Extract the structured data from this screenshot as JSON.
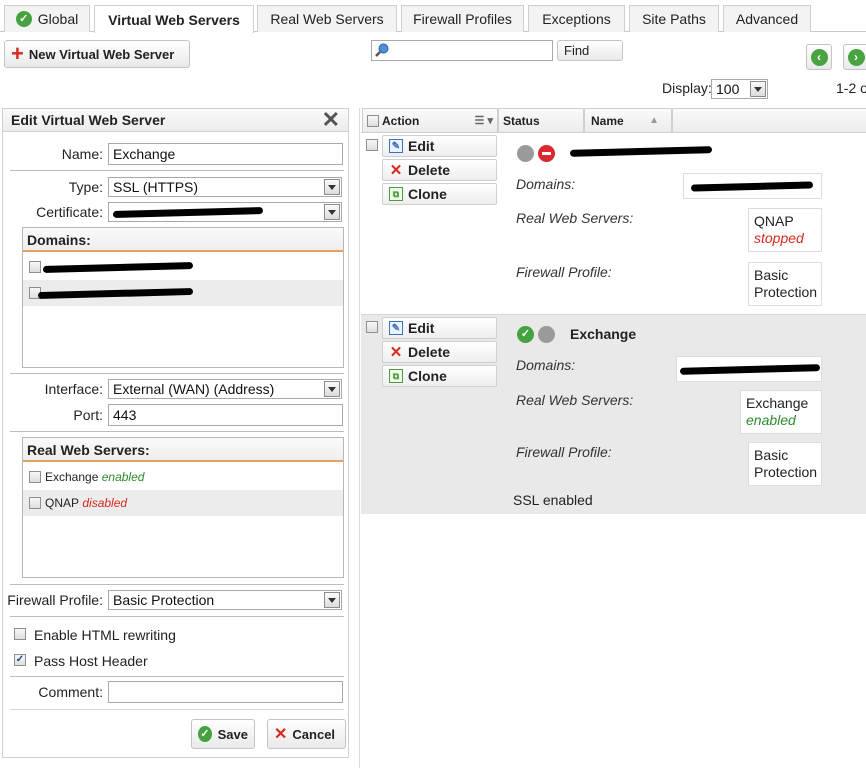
{
  "tabs": [
    {
      "label": "Global",
      "icon": "check-circle-icon"
    },
    {
      "label": "Virtual Web Servers",
      "active": true
    },
    {
      "label": "Real Web Servers"
    },
    {
      "label": "Firewall Profiles"
    },
    {
      "label": "Exceptions"
    },
    {
      "label": "Site Paths"
    },
    {
      "label": "Advanced"
    }
  ],
  "toolbar": {
    "new_button": "New Virtual Web Server",
    "search_value": "",
    "find_button": "Find",
    "display_label": "Display:",
    "display_value": "100",
    "pager_text": "1-2 o"
  },
  "edit_panel": {
    "title": "Edit Virtual Web Server",
    "name_label": "Name:",
    "name_value": "Exchange",
    "type_label": "Type:",
    "type_value": "SSL (HTTPS)",
    "certificate_label": "Certificate:",
    "domains_header": "Domains:",
    "interface_label": "Interface:",
    "interface_value": "External (WAN) (Address)",
    "port_label": "Port:",
    "port_value": "443",
    "real_servers_header": "Real Web Servers:",
    "real_servers": [
      {
        "name": "Exchange",
        "status": "enabled",
        "checked": false
      },
      {
        "name": "QNAP",
        "status": "disabled",
        "checked": false
      }
    ],
    "firewall_label": "Firewall Profile:",
    "firewall_value": "Basic Protection",
    "html_rewriting_label": "Enable HTML rewriting",
    "html_rewriting_checked": false,
    "pass_host_label": "Pass Host Header",
    "pass_host_checked": true,
    "comment_label": "Comment:",
    "comment_value": "",
    "save_button": "Save",
    "cancel_button": "Cancel"
  },
  "grid": {
    "headers": {
      "action": "Action",
      "status": "Status",
      "name": "Name"
    },
    "rows": [
      {
        "status": "disabled",
        "name": "",
        "domains_label": "Domains:",
        "real_servers_label": "Real Web Servers:",
        "real_server_name": "QNAP",
        "real_server_status": "stopped",
        "firewall_label": "Firewall Profile:",
        "firewall_value_1": "Basic",
        "firewall_value_2": "Protection",
        "footer": ""
      },
      {
        "status": "enabled",
        "name": "Exchange",
        "domains_label": "Domains:",
        "real_servers_label": "Real Web Servers:",
        "real_server_name": "Exchange",
        "real_server_status": "enabled",
        "firewall_label": "Firewall Profile:",
        "firewall_value_1": "Basic",
        "firewall_value_2": "Protection",
        "footer": "SSL enabled"
      }
    ],
    "actions": {
      "edit": "Edit",
      "delete": "Delete",
      "clone": "Clone"
    }
  },
  "colors": {
    "accent_green": "#45a33f",
    "danger_red": "#d62a1e",
    "header_border": "#e2a061"
  }
}
